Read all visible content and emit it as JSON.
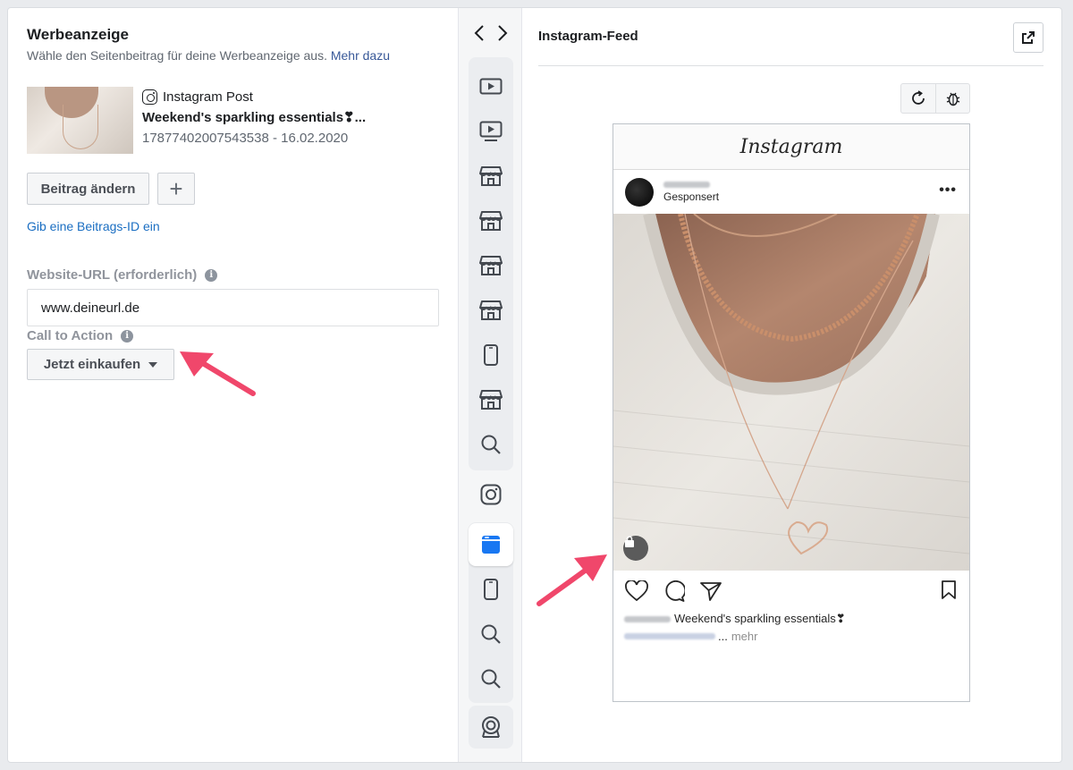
{
  "left": {
    "title": "Werbeanzeige",
    "subtitle": "Wähle den Seitenbeitrag für deine Werbeanzeige aus.",
    "more_link": "Mehr dazu",
    "post": {
      "type_label": "Instagram Post",
      "name": "Weekend's sparkling essentials❣...",
      "meta": "17877402007543538 - 16.02.2020"
    },
    "change_post_button": "Beitrag ändern",
    "add_button": "+",
    "enter_id_link": "Gib eine Beitrags-ID ein",
    "website_label": "Website-URL (erforderlich)",
    "website_value": "www.deineurl.de",
    "cta_label": "Call to Action",
    "cta_value": "Jetzt einkaufen",
    "info_glyph": "i"
  },
  "middle": {
    "prev_icon": "chevron-left-icon",
    "next_icon": "chevron-right-icon",
    "placements": [
      "video-feed-icon",
      "video-stream-icon",
      "marketplace-icon",
      "marketplace-icon",
      "marketplace-icon",
      "marketplace-icon",
      "phone-icon",
      "marketplace-icon",
      "search-icon",
      "instagram-icon",
      "instagram-feed-icon",
      "phone-icon",
      "search-icon",
      "search-icon",
      "audience-network-icon"
    ],
    "active_index": 10
  },
  "right": {
    "title": "Instagram-Feed",
    "external_icon": "external-link-icon",
    "refresh_icon": "refresh-icon",
    "bug_icon": "bug-icon"
  },
  "preview": {
    "app_name": "Instagram",
    "sponsored": "Gesponsert",
    "more": "•••",
    "caption": "Weekend's sparkling essentials❣",
    "caption_more_dots": "...",
    "caption_more": "mehr"
  },
  "colors": {
    "link": "#385898",
    "link_blue": "#1a6ec2",
    "active_tab": "#1877f2",
    "annotation_arrow": "#f0476b"
  }
}
